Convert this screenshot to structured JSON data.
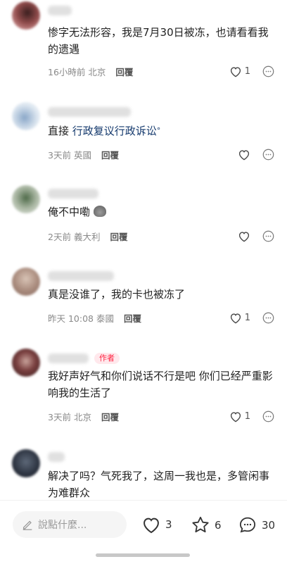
{
  "comments": [
    {
      "text": "惨字无法形容，我是7月30日被冻，也请看看我的遗遇",
      "time": "16小時前",
      "location": "北京",
      "reply": "回覆",
      "likes": "1",
      "avatar_color": "#6b3a3a",
      "author": false
    },
    {
      "text": "直接 ",
      "link": "行政复议行政诉讼",
      "time": "3天前",
      "location": "英國",
      "reply": "回覆",
      "likes": "",
      "avatar_color": "#c9d6e6",
      "author": false
    },
    {
      "text": "俺不中嘞",
      "time": "2天前",
      "location": "義大利",
      "reply": "回覆",
      "likes": "",
      "avatar_color": "#a8b3a0",
      "author": false
    },
    {
      "text": "真是没谁了，我的卡也被冻了",
      "time": "昨天 10:08",
      "location": "泰國",
      "reply": "回覆",
      "likes": "1",
      "avatar_color": "#b59a8c",
      "author": false
    },
    {
      "text": "我好声好气和你们说话不行是吧 你们已经严重影响我的生活了",
      "time": "3天前",
      "location": "北京",
      "reply": "回覆",
      "likes": "1",
      "avatar_color": "#5a2f2f",
      "author": true,
      "author_tag": "作者"
    },
    {
      "text": "解决了吗？气死我了，这周一我也是，多管闲事为难群众",
      "time": "",
      "location": "",
      "reply": "",
      "likes": "",
      "avatar_color": "#2c3340",
      "author": false
    }
  ],
  "bottom_bar": {
    "input_placeholder": "說點什麼...",
    "likes": "3",
    "stars": "6",
    "comments": "30"
  },
  "colors": {
    "accent": "#ff2442",
    "link": "#13386c"
  },
  "icons": [
    "heart-icon",
    "more-icon",
    "pencil-icon",
    "star-icon",
    "comment-icon",
    "poop-emoji"
  ]
}
